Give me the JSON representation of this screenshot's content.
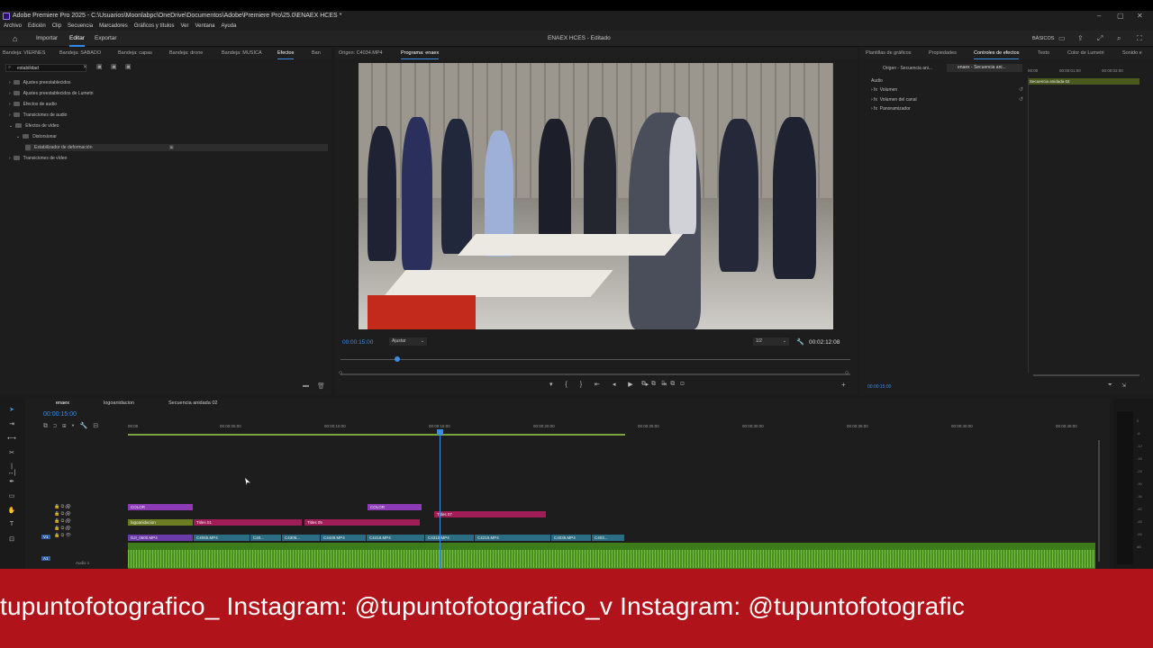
{
  "window": {
    "title": "Adobe Premiere Pro 2025 - C:\\Usuarios\\Moonlabpc\\OneDrive\\Documentos\\Adobe\\Premiere Pro\\25.0\\ENAEX HCES *",
    "minimize": "–",
    "maximize": "▢",
    "close": "✕"
  },
  "menu": [
    "Archivo",
    "Edición",
    "Clip",
    "Secuencia",
    "Marcadores",
    "Gráficos y títulos",
    "Ver",
    "Ventana",
    "Ayuda"
  ],
  "workspace": {
    "home_icon": "home-icon",
    "tabs": [
      "Importar",
      "Editar",
      "Exportar"
    ],
    "active_tab": "Editar",
    "project_title": "ENAEX HCES - Editado",
    "layout_label": "BÁSICOS"
  },
  "project_panel": {
    "tabs": [
      "Bandeja: VIERNES",
      "Bandeja: SABADO",
      "Bandeja: capas",
      "Bandeja: drone",
      "Bandeja: MUSICA",
      "Efectos",
      "Ban"
    ],
    "active_tab": "Efectos",
    "search_value": "estabilidad",
    "effects": [
      {
        "label": "Ajustes preestablecidos",
        "indent": 0
      },
      {
        "label": "Ajustes preestablecidos de Lumetri",
        "indent": 0
      },
      {
        "label": "Efectos de audio",
        "indent": 0
      },
      {
        "label": "Transiciones de audio",
        "indent": 0
      },
      {
        "label": "Efectos de vídeo",
        "indent": 0
      },
      {
        "label": "Distorsionar",
        "indent": 1
      },
      {
        "label": "Estabilizador de deformación",
        "indent": 2
      },
      {
        "label": "Transiciones de vídeo",
        "indent": 0
      }
    ]
  },
  "program_monitor": {
    "tabs": [
      "Origen: C4034.MP4",
      "Programa: enaex"
    ],
    "active_tab": "Programa: enaex",
    "current_time": "00:00:15:00",
    "fit": "Ajustar",
    "quality": "1/2",
    "duration": "00:02:12:08",
    "transport": "▾ { } ⇤ ◂ ▶ ▸ ⇥"
  },
  "effect_controls": {
    "tabs": [
      "Plantillas de gráficos",
      "Propiedades",
      "Controles de efectos",
      "Texto",
      "Color de Lumetri",
      "Sonido e"
    ],
    "active_tab": "Controles de efectos",
    "source_label": "Origen - Secuencia ani...",
    "target_label": "enaex - Secuencia ani...",
    "times": [
      "00:00",
      "00:00:01:00",
      "00:00:02:00"
    ],
    "clip_label": "Secuencia anidada 02",
    "section": "Audio",
    "props": [
      "Volumen",
      "Volumen del canal",
      "Panoramizador"
    ],
    "footer_time": "00:00:15:00"
  },
  "sequence": {
    "tabs": [
      "enaex",
      "logoanidacion",
      "Secuencia anidada 02"
    ],
    "active_tab": "enaex",
    "timecode": "00:00:15:00",
    "ruler": [
      "00:00",
      "00:00:05:00",
      "00:00:10:00",
      "00:00:15:00",
      "00:00:20:00",
      "00:00:25:00",
      "00:00:30:00",
      "00:00:35:00",
      "00:00:40:00",
      "00:00:45:00"
    ],
    "tracks": [
      "V5",
      "V4",
      "V3",
      "V2",
      "V1",
      "A1"
    ],
    "audio_label": "Audio 1",
    "clips": [
      {
        "label": "COLOR",
        "track": "V5"
      },
      {
        "label": "COLOR",
        "track": "V5"
      },
      {
        "label": "Titles 07",
        "track": "V4"
      },
      {
        "label": "logoanidacion",
        "track": "V3"
      },
      {
        "label": "Titles 01",
        "track": "V3"
      },
      {
        "label": "Titles 05",
        "track": "V3"
      },
      {
        "label": "DJI_0600.MP4",
        "track": "V1"
      },
      {
        "label": "C4065.MP4",
        "track": "V1"
      },
      {
        "label": "C40...",
        "track": "V1"
      },
      {
        "label": "C4306...",
        "track": "V1"
      },
      {
        "label": "C4449.MP4",
        "track": "V1"
      },
      {
        "label": "C4418.MP4",
        "track": "V1"
      },
      {
        "label": "C4310.MP4",
        "track": "V1"
      },
      {
        "label": "C4215.MP4",
        "track": "V1"
      },
      {
        "label": "C4036.MP4",
        "track": "V1"
      },
      {
        "label": "C403...",
        "track": "V1"
      }
    ]
  },
  "banner": {
    "text": "tupuntofotografico_  Instagram: @tupuntofotografico_v Instagram: @tupuntofotografic"
  },
  "colors": {
    "accent": "#3a8de0",
    "banner": "#b0141a",
    "audio_clip": "#3e7c1b",
    "color_clip": "#8c3ab5",
    "title_clip": "#a11d57",
    "video_clip": "#2b6d83",
    "nested_clip": "#6b7d23"
  }
}
